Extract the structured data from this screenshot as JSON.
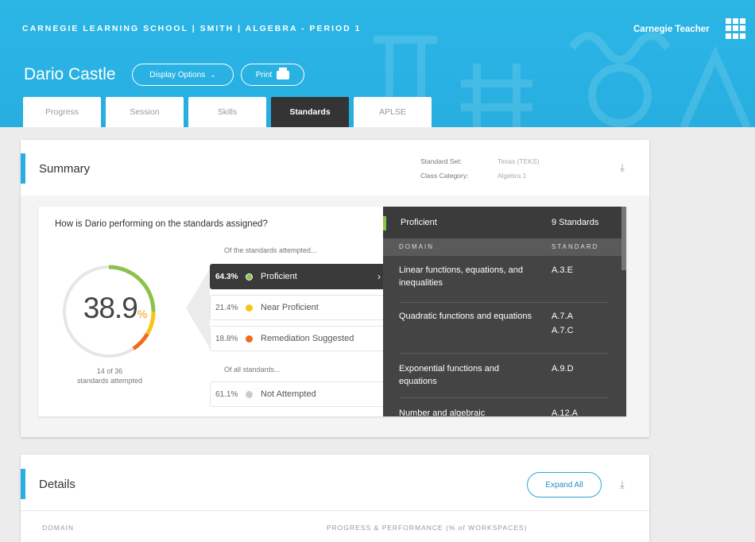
{
  "header": {
    "school": "CARNEGIE LEARNING SCHOOL | SMITH | ALGEBRA - PERIOD 1",
    "brand": "Carnegie Teacher",
    "student": "Dario Castle",
    "display_options": "Display Options",
    "print": "Print"
  },
  "tabs": [
    {
      "label": "Progress"
    },
    {
      "label": "Session"
    },
    {
      "label": "Skills"
    },
    {
      "label": "Standards"
    },
    {
      "label": "APLSE"
    }
  ],
  "summary": {
    "title": "Summary",
    "standard_set_label": "Standard Set:",
    "standard_set_value": "Texas (TEKS)",
    "class_category_label": "Class Category:",
    "class_category_value": "Algebra 1",
    "question": "How is Dario performing on the standards assigned?",
    "percent": "38.9",
    "percent_sign": "%",
    "attempted_line1": "14 of 36",
    "attempted_line2": "standards attempted",
    "of_attempted": "Of the standards attempted...",
    "of_all": "Of all standards...",
    "rows": [
      {
        "pct": "64.3%",
        "label": "Proficient",
        "color": "#8bc34a"
      },
      {
        "pct": "21.4%",
        "label": "Near Proficient",
        "color": "#f5c518"
      },
      {
        "pct": "18.8%",
        "label": "Remediation Suggested",
        "color": "#f26b21"
      },
      {
        "pct": "61.1%",
        "label": "Not Attempted",
        "color": "#cccccc"
      }
    ],
    "gauge": {
      "proficient": 0.643,
      "near": 0.214,
      "remediation": 0.188,
      "attempted_fraction": 0.389
    }
  },
  "panel": {
    "label": "Proficient",
    "count": "9 Standards",
    "col_domain": "DOMAIN",
    "col_standard": "STANDARD",
    "rows": [
      {
        "domain": "Linear functions, equations, and inequalities",
        "standards": [
          "A.3.E"
        ]
      },
      {
        "domain": "Quadratic functions and equations",
        "standards": [
          "A.7.A",
          "A.7.C"
        ]
      },
      {
        "domain": "Exponential functions and equations",
        "standards": [
          "A.9.D"
        ]
      },
      {
        "domain": "Number and algebraic",
        "standards": [
          "A.12.A"
        ]
      }
    ]
  },
  "details": {
    "title": "Details",
    "expand_all": "Expand All",
    "col_domain": "DOMAIN",
    "col_progress": "PROGRESS & PERFORMANCE (% of WORKSPACES)"
  }
}
